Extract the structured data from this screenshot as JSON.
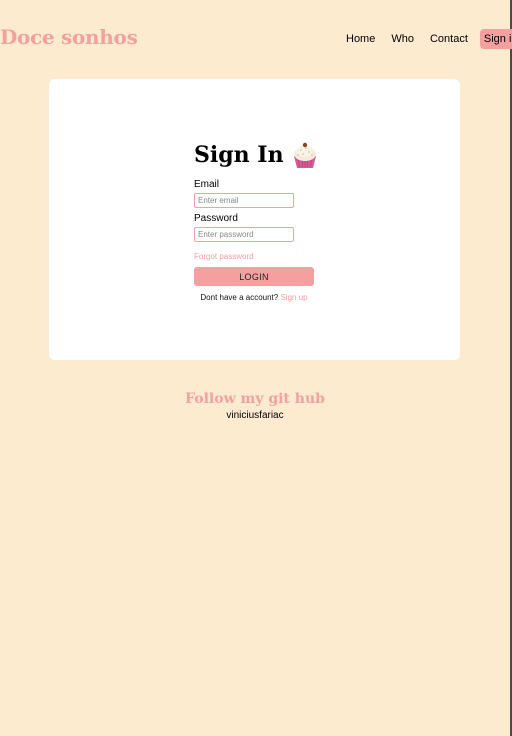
{
  "header": {
    "brand": "Doce sonhos",
    "nav": [
      {
        "label": "Home"
      },
      {
        "label": "Who"
      },
      {
        "label": "Contact"
      },
      {
        "label": "Sign in"
      }
    ]
  },
  "signin": {
    "title": "Sign In",
    "icon": "cupcake-icon",
    "email_label": "Email",
    "email_placeholder": "Enter email",
    "password_label": "Password",
    "password_placeholder": "Enter password",
    "forgot": "Forgot password",
    "login": "LOGIN",
    "signup_prompt": "Dont have a account?",
    "signup_link": "Sign up"
  },
  "footer": {
    "follow": "Follow my git hub",
    "handle": "viniciusfariac"
  },
  "colors": {
    "background": "#fdebd0",
    "accent": "#f4a0a0",
    "card": "#ffffff"
  }
}
